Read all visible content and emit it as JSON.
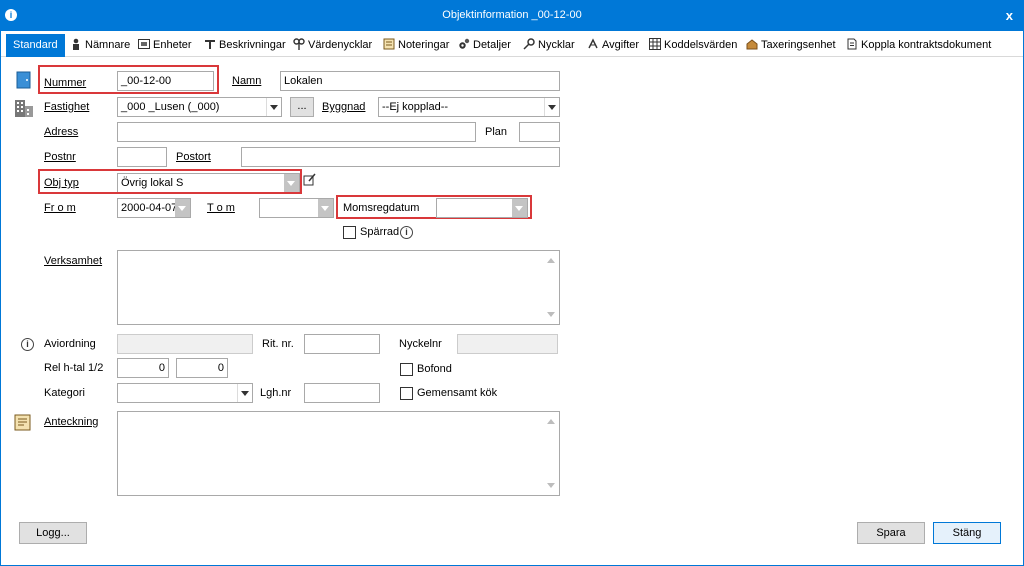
{
  "window": {
    "title": "Objektinformation _00-12-00",
    "close_glyph": "x"
  },
  "tabs": [
    {
      "label": "Standard",
      "icon": ""
    },
    {
      "label": "Nämnare",
      "icon": "person-icon"
    },
    {
      "label": "Enheter",
      "icon": "units-icon"
    },
    {
      "label": "Beskrivningar",
      "icon": "description-icon"
    },
    {
      "label": "Värdenycklar",
      "icon": "value-keys-icon"
    },
    {
      "label": "Noteringar",
      "icon": "notes-icon"
    },
    {
      "label": "Detaljer",
      "icon": "gears-icon"
    },
    {
      "label": "Nycklar",
      "icon": "key-icon"
    },
    {
      "label": "Avgifter",
      "icon": "fees-icon"
    },
    {
      "label": "Koddelsvärden",
      "icon": "grid-icon"
    },
    {
      "label": "Taxeringsenhet",
      "icon": "building-icon"
    },
    {
      "label": "Koppla kontraktsdokument",
      "icon": "document-icon"
    }
  ],
  "form": {
    "nummer": {
      "label": "Nummer",
      "value": "_00-12-00"
    },
    "namn": {
      "label": "Namn",
      "value": "Lokalen"
    },
    "fastighet": {
      "label": "Fastighet",
      "value": "_000 _Lusen (_000)",
      "browse": "..."
    },
    "byggnad": {
      "label": "Byggnad",
      "value": "--Ej kopplad--"
    },
    "adress": {
      "label": "Adress",
      "value": ""
    },
    "plan": {
      "label": "Plan",
      "value": ""
    },
    "postnr": {
      "label": "Postnr",
      "value": ""
    },
    "postort": {
      "label": "Postort",
      "value": ""
    },
    "obj_typ": {
      "label": "Obj typ",
      "value": "Övrig lokal S"
    },
    "from": {
      "label": "Fr o m",
      "value": "2000-04-07"
    },
    "tom": {
      "label": "T o m",
      "value": ""
    },
    "momsregdatum": {
      "label": "Momsregdatum",
      "value": ""
    },
    "sparrad": {
      "label": "Spärrad"
    },
    "verksamhet": {
      "label": "Verksamhet",
      "value": ""
    },
    "aviordning": {
      "label": "Aviordning",
      "value": ""
    },
    "rit_nr": {
      "label": "Rit. nr.",
      "value": ""
    },
    "nyckelnr": {
      "label": "Nyckelnr",
      "value": ""
    },
    "rel_htal": {
      "label": "Rel h-tal 1/2",
      "value1": "0",
      "value2": "0"
    },
    "bofond": {
      "label": "Bofond"
    },
    "kategori": {
      "label": "Kategori",
      "value": ""
    },
    "lgh_nr": {
      "label": "Lgh.nr",
      "value": ""
    },
    "gemensamt_kok": {
      "label": "Gemensamt kök"
    },
    "anteckning": {
      "label": "Anteckning",
      "value": ""
    }
  },
  "buttons": {
    "logg": "Logg...",
    "spara": "Spara",
    "stang": "Stäng"
  },
  "colors": {
    "accent": "#0078d7",
    "highlight": "#d9383a"
  }
}
